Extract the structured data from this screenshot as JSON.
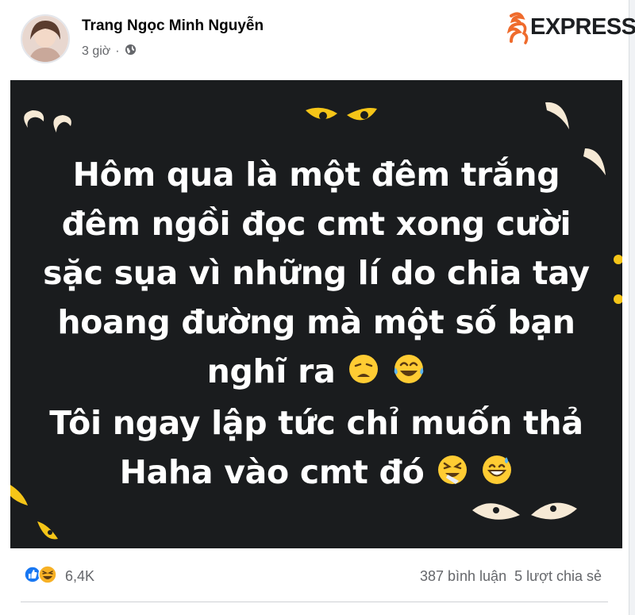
{
  "post": {
    "author": "Trang Ngọc Minh Nguyễn",
    "time": "3 giờ",
    "privacy_icon": "globe-icon",
    "logo_text": "EXPRESS",
    "lines": [
      "Hôm qua là một đêm trắng",
      "đêm ngồi đọc cmt xong cười",
      "sặc sụa vì những lí do chia tay",
      "hoang đường mà một số bạn",
      "nghĩ ra",
      "Tôi ngay lập tức chỉ muốn thả",
      "Haha vào cmt đó"
    ]
  },
  "footer": {
    "reaction_icons": [
      "like-icon",
      "haha-icon"
    ],
    "reaction_count": "6,4K",
    "comments": "387 bình luận",
    "shares": "5 lượt chia sẻ"
  },
  "colors": {
    "image_bg": "#1a1c1e",
    "eye_yellow": "#f5c518",
    "muted_text": "#65676b"
  }
}
